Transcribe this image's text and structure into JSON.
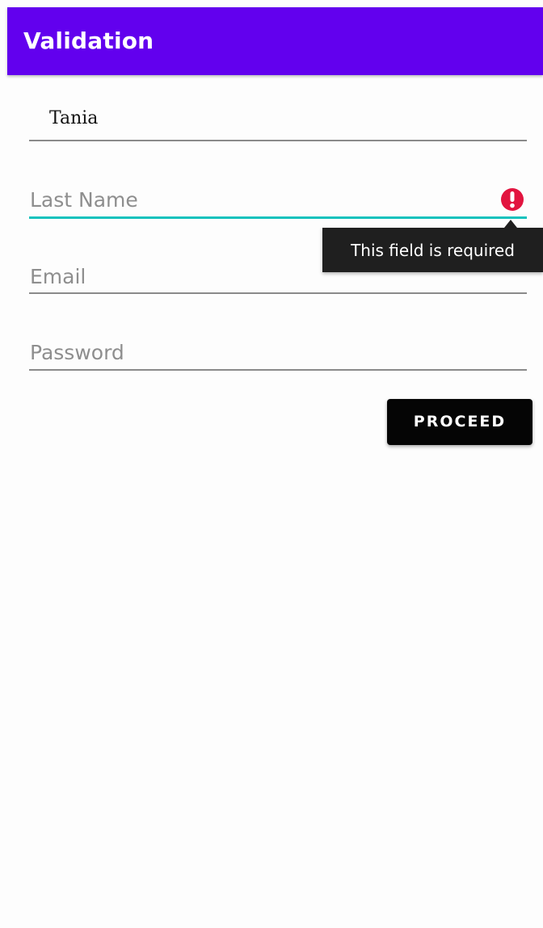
{
  "app_bar": {
    "title": "Validation",
    "color": "#6200ee"
  },
  "form": {
    "first_name": {
      "value": "Tania"
    },
    "last_name": {
      "placeholder": "Last Name",
      "value": "",
      "focused": true,
      "accent_color": "#13c2bd",
      "error_icon": "error-circle-icon",
      "error_color": "#e2143f",
      "error_message": "This field is required"
    },
    "email": {
      "placeholder": "Email",
      "value": ""
    },
    "password": {
      "placeholder": "Password",
      "value": ""
    },
    "proceed_label": "PROCEED"
  }
}
